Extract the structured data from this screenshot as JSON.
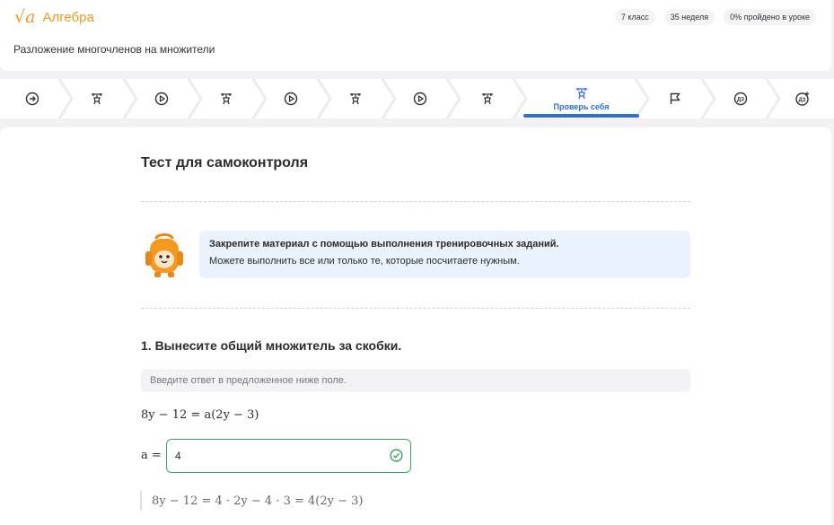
{
  "app": {
    "logo_symbol": "√a",
    "subject": "Алгебра",
    "badges": [
      "7 класс",
      "35 неделя",
      "0% пройдено в уроке"
    ],
    "lesson_title": "Разложение многочленов на множители"
  },
  "steps": {
    "active_label": "Проверь себя",
    "icons": [
      "arrow-circle-icon",
      "trainer-icon",
      "play-circle-icon",
      "trainer-icon",
      "play-circle-icon",
      "trainer-icon",
      "play-circle-icon",
      "trainer-icon",
      "trainer-icon",
      "flag-icon",
      "homework-icon",
      "homework-plus-icon"
    ]
  },
  "content": {
    "section_title": "Тест для самоконтроля",
    "info_line1": "Закрепите материал с помощью выполнения тренировочных заданий.",
    "info_line2": "Можете выполнить все или только те, которые посчитаете нужным.",
    "task_title": "1. Вынесите общий множитель за скобки.",
    "hint": "Введите ответ в предложенное ниже поле.",
    "equation": "8y − 12 = a(2y − 3)",
    "answer_label": "a =",
    "answer_value": "4",
    "solution": "8y − 12 = 4 · 2y − 4 · 3 = 4(2y − 3)"
  },
  "colors": {
    "accent": "#f39a1e",
    "active": "#2f6fd6",
    "success": "#3ba55c",
    "info_bg": "#eaf3fd"
  }
}
